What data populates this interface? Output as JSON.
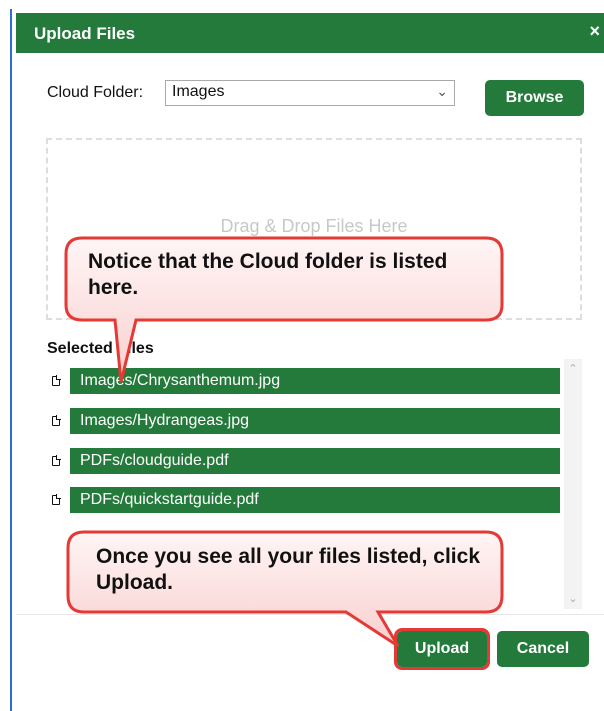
{
  "dialog": {
    "title": "Upload Files",
    "close_glyph": "×"
  },
  "cloud_folder": {
    "label": "Cloud Folder:",
    "value": "Images"
  },
  "browse_label": "Browse",
  "dropzone_text": "Drag & Drop Files Here",
  "selected_files_label": "Selected Files",
  "files": [
    "Images/Chrysanthemum.jpg",
    "Images/Hydrangeas.jpg",
    "PDFs/cloudguide.pdf",
    "PDFs/quickstartguide.pdf"
  ],
  "upload_label": "Upload",
  "cancel_label": "Cancel",
  "callouts": {
    "folder_note": "Notice that the Cloud folder is listed here.",
    "upload_note": "Once you see all your files listed, click Upload."
  },
  "icons": {
    "close": "close-icon",
    "dropdown": "chevron-down-icon",
    "file": "file-icon"
  },
  "colors": {
    "accent_green": "#237a3b",
    "highlight_red": "#e53935",
    "callout_fill": "#fde7e7"
  }
}
